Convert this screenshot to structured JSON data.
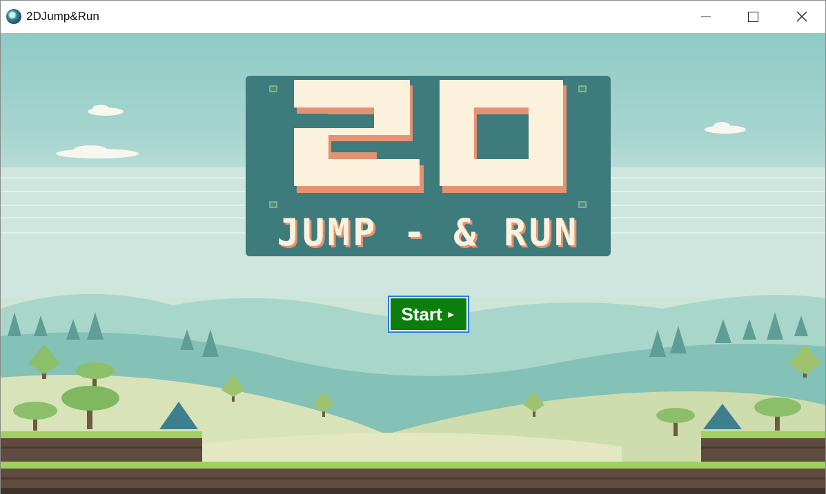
{
  "window": {
    "title": "2DJump&Run",
    "icon": "game-globe-icon",
    "controls": {
      "minimize": "minimize-icon",
      "maximize": "maximize-icon",
      "close": "close-icon"
    }
  },
  "logo": {
    "big_text": "2D",
    "sub_text": "JUMP - & RUN",
    "colors": {
      "panel": "#3d7b7c",
      "letters": "#fbf1dc",
      "shadow": "#e39372"
    }
  },
  "start_button": {
    "label": "Start",
    "arrow": "►",
    "color": "#0c7e0c",
    "focus_border": "#2b7ae0"
  }
}
